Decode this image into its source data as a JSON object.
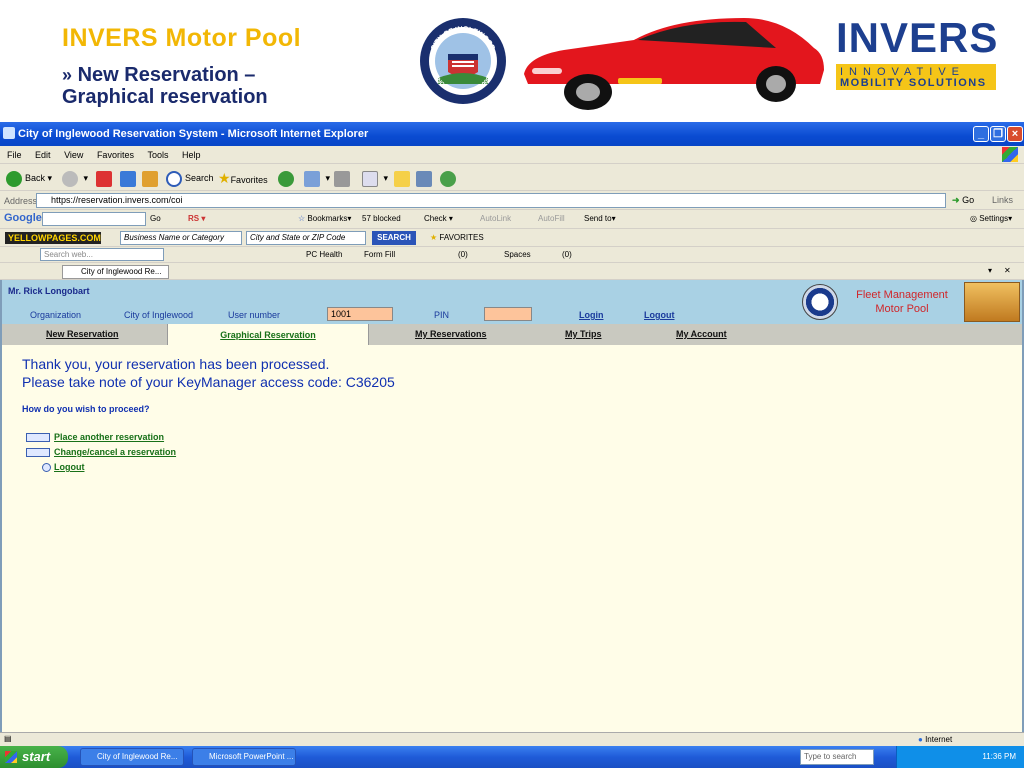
{
  "slide": {
    "title": "INVERS Motor Pool",
    "subtitle_arrow": "»",
    "subtitle_line1": "New Reservation –",
    "subtitle_line2": "Graphical reservation",
    "seal_text_top": "CITY OF INGLEWOOD",
    "seal_text_bottom": "INC. CALIFORNIA 1908",
    "invers_logo": "INVERS",
    "invers_tag1": "INNOVATIVE",
    "invers_tag2": "MOBILITY SOLUTIONS"
  },
  "window": {
    "title": "City of Inglewood Reservation System - Microsoft Internet Explorer",
    "menu": [
      "File",
      "Edit",
      "View",
      "Favorites",
      "Tools",
      "Help"
    ],
    "toolbar": {
      "back": "Back",
      "search": "Search",
      "favorites": "Favorites"
    },
    "address_label": "Address",
    "address_value": "https://reservation.invers.com/coi",
    "go_label": "Go",
    "links_label": "Links"
  },
  "google_bar": {
    "logo": "Google",
    "go": "Go",
    "bookmarks": "Bookmarks",
    "blocked": "57 blocked",
    "check": "Check",
    "autolink": "AutoLink",
    "autofill": "AutoFill",
    "send_to": "Send to",
    "settings": "Settings"
  },
  "yp_bar": {
    "logo": "YELLOWPAGES.COM",
    "business_placeholder": "Business Name or Category",
    "city_placeholder": "City and State or ZIP Code",
    "search_btn": "SEARCH",
    "favorites": "FAVORITES"
  },
  "search_bar": {
    "placeholder": "Search web...",
    "pc_health": "PC Health",
    "form_fill": "Form Fill",
    "mail_count": "(0)",
    "spaces": "Spaces",
    "people_count": "(0)"
  },
  "tab": {
    "label": "City of Inglewood Re..."
  },
  "app": {
    "user_name": "Mr. Rick Longobart",
    "organization_label": "Organization",
    "organization_value": "City of Inglewood",
    "user_number_label": "User number",
    "user_number_value": "1001",
    "pin_label": "PIN",
    "pin_value": "",
    "login": "Login",
    "logout": "Logout",
    "fleet_line1": "Fleet Management",
    "fleet_line2": "Motor Pool",
    "nav": {
      "new_reservation": "New Reservation",
      "graphical_reservation": "Graphical Reservation",
      "my_reservations": "My Reservations",
      "my_trips": "My Trips",
      "my_account": "My Account"
    },
    "message_line1": "Thank you, your reservation has been processed.",
    "message_line2": "Please take note of your KeyManager access code: C36205",
    "proceed_question": "How do you wish to proceed?",
    "option_place": "Place another reservation",
    "option_change": "Change/cancel a reservation",
    "option_logout": "Logout"
  },
  "status": {
    "zone": "Internet"
  },
  "taskbar": {
    "start": "start",
    "task1": "City of Inglewood Re...",
    "task2": "Microsoft PowerPoint ...",
    "search_placeholder": "Type to search",
    "clock": "11:36 PM"
  }
}
